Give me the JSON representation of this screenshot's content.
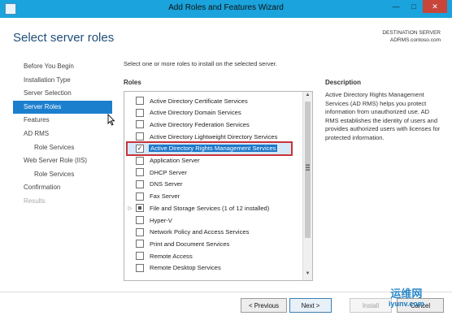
{
  "window": {
    "title": "Add Roles and Features Wizard",
    "minimize": "—",
    "maximize": "□",
    "close": "✕"
  },
  "page": {
    "heading": "Select server roles"
  },
  "destination": {
    "label": "DESTINATION SERVER",
    "server": "ADRMS.contoso.com"
  },
  "nav": [
    {
      "label": "Before You Begin",
      "state": "normal",
      "sub": false
    },
    {
      "label": "Installation Type",
      "state": "normal",
      "sub": false
    },
    {
      "label": "Server Selection",
      "state": "normal",
      "sub": false
    },
    {
      "label": "Server Roles",
      "state": "active",
      "sub": false
    },
    {
      "label": "Features",
      "state": "normal",
      "sub": false
    },
    {
      "label": "AD RMS",
      "state": "normal",
      "sub": false
    },
    {
      "label": "Role Services",
      "state": "normal",
      "sub": true
    },
    {
      "label": "Web Server Role (IIS)",
      "state": "normal",
      "sub": false
    },
    {
      "label": "Role Services",
      "state": "normal",
      "sub": true
    },
    {
      "label": "Confirmation",
      "state": "normal",
      "sub": false
    },
    {
      "label": "Results",
      "state": "disabled",
      "sub": false
    }
  ],
  "main": {
    "intro": "Select one or more roles to install on the selected server.",
    "roles_label": "Roles",
    "description_label": "Description",
    "description": "Active Directory Rights Management Services (AD RMS) helps you protect information from unauthorized use. AD RMS establishes the identity of users and provides authorized users with licenses for protected information."
  },
  "roles": [
    {
      "label": "Active Directory Certificate Services",
      "checked": false,
      "expandable": false,
      "selected": false,
      "partial": false
    },
    {
      "label": "Active Directory Domain Services",
      "checked": false,
      "expandable": false,
      "selected": false,
      "partial": false
    },
    {
      "label": "Active Directory Federation Services",
      "checked": false,
      "expandable": false,
      "selected": false,
      "partial": false
    },
    {
      "label": "Active Directory Lightweight Directory Services",
      "checked": false,
      "expandable": false,
      "selected": false,
      "partial": false
    },
    {
      "label": "Active Directory Rights Management Services",
      "checked": true,
      "expandable": false,
      "selected": true,
      "partial": false
    },
    {
      "label": "Application Server",
      "checked": false,
      "expandable": false,
      "selected": false,
      "partial": false
    },
    {
      "label": "DHCP Server",
      "checked": false,
      "expandable": false,
      "selected": false,
      "partial": false
    },
    {
      "label": "DNS Server",
      "checked": false,
      "expandable": false,
      "selected": false,
      "partial": false
    },
    {
      "label": "Fax Server",
      "checked": false,
      "expandable": false,
      "selected": false,
      "partial": false
    },
    {
      "label": "File and Storage Services (1 of 12 installed)",
      "checked": false,
      "expandable": true,
      "selected": false,
      "partial": true
    },
    {
      "label": "Hyper-V",
      "checked": false,
      "expandable": false,
      "selected": false,
      "partial": false
    },
    {
      "label": "Network Policy and Access Services",
      "checked": false,
      "expandable": false,
      "selected": false,
      "partial": false
    },
    {
      "label": "Print and Document Services",
      "checked": false,
      "expandable": false,
      "selected": false,
      "partial": false
    },
    {
      "label": "Remote Access",
      "checked": false,
      "expandable": false,
      "selected": false,
      "partial": false
    },
    {
      "label": "Remote Desktop Services",
      "checked": false,
      "expandable": false,
      "selected": false,
      "partial": false
    }
  ],
  "footer": {
    "previous": "< Previous",
    "next": "Next >",
    "install": "Install",
    "cancel": "Cancel"
  },
  "watermark": {
    "line1": "运维网",
    "line2": "iyunv.com"
  },
  "colors": {
    "accent": "#1c7fce",
    "titlebar": "#1aa3dc",
    "highlight_border": "#c8333a"
  }
}
